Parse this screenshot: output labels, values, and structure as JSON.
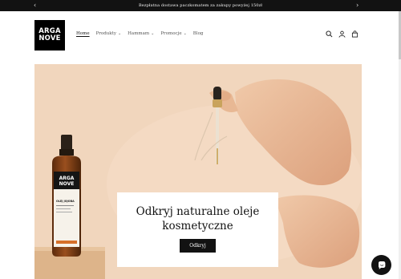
{
  "announcement": {
    "text": "Bezpłatna dostawa paczkomatem za zakupy powyżej 150zł",
    "prev_icon": "chevron-left-icon",
    "next_icon": "chevron-right-icon"
  },
  "logo": {
    "line1": "ARGA",
    "line2": "NOVE"
  },
  "nav": {
    "home": "Home",
    "produkty": "Produkty",
    "hammam": "Hammam",
    "promocje": "Promocje",
    "blog": "Blog"
  },
  "header_icons": [
    "search-icon",
    "account-icon",
    "cart-icon"
  ],
  "product_label": {
    "brand_line1": "ARGA",
    "brand_line2": "NOVE",
    "name": "OLEJ JOJOBA"
  },
  "hero": {
    "title": "Odkryj naturalne oleje kosmetyczne",
    "button": "Odkryj"
  },
  "colors": {
    "announcement_bg": "#121212",
    "hero_bg": "#f1d6bd",
    "button_bg": "#121212",
    "bottle": "#7a3b14"
  }
}
